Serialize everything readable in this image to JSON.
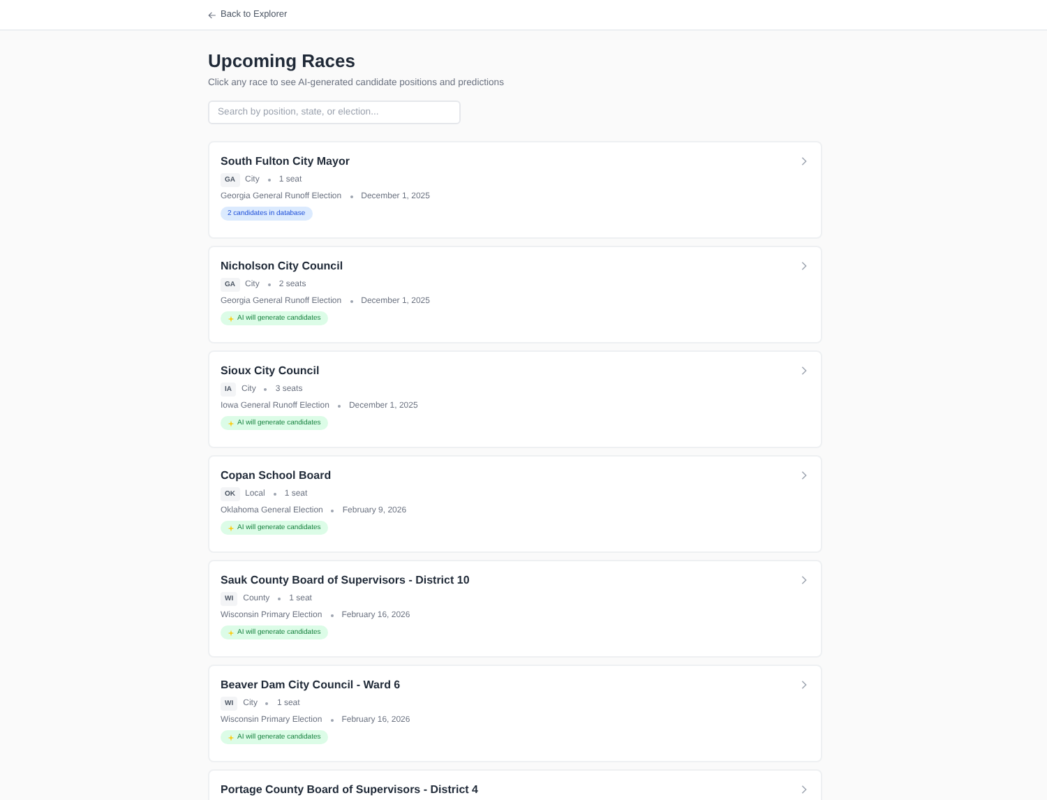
{
  "back_link": "Back to Explorer",
  "title": "Upcoming Races",
  "subtitle": "Click any race to see AI-generated candidate positions and predictions",
  "search": {
    "placeholder": "Search by position, state, or election..."
  },
  "races": [
    {
      "name": "South Fulton City Mayor",
      "state": "GA",
      "level": "City",
      "seats": "1 seat",
      "election": "Georgia General Runoff Election",
      "date": "December 1, 2025",
      "badge": {
        "kind": "database",
        "text": "2 candidates in database"
      }
    },
    {
      "name": "Nicholson City Council",
      "state": "GA",
      "level": "City",
      "seats": "2 seats",
      "election": "Georgia General Runoff Election",
      "date": "December 1, 2025",
      "badge": {
        "kind": "ai",
        "text": "AI will generate candidates"
      }
    },
    {
      "name": "Sioux City Council",
      "state": "IA",
      "level": "City",
      "seats": "3 seats",
      "election": "Iowa General Runoff Election",
      "date": "December 1, 2025",
      "badge": {
        "kind": "ai",
        "text": "AI will generate candidates"
      }
    },
    {
      "name": "Copan School Board",
      "state": "OK",
      "level": "Local",
      "seats": "1 seat",
      "election": "Oklahoma General Election",
      "date": "February 9, 2026",
      "badge": {
        "kind": "ai",
        "text": "AI will generate candidates"
      }
    },
    {
      "name": "Sauk County Board of Supervisors - District 10",
      "state": "WI",
      "level": "County",
      "seats": "1 seat",
      "election": "Wisconsin Primary Election",
      "date": "February 16, 2026",
      "badge": {
        "kind": "ai",
        "text": "AI will generate candidates"
      }
    },
    {
      "name": "Beaver Dam City Council - Ward 6",
      "state": "WI",
      "level": "City",
      "seats": "1 seat",
      "election": "Wisconsin Primary Election",
      "date": "February 16, 2026",
      "badge": {
        "kind": "ai",
        "text": "AI will generate candidates"
      }
    },
    {
      "name": "Portage County Board of Supervisors - District 4"
    }
  ]
}
